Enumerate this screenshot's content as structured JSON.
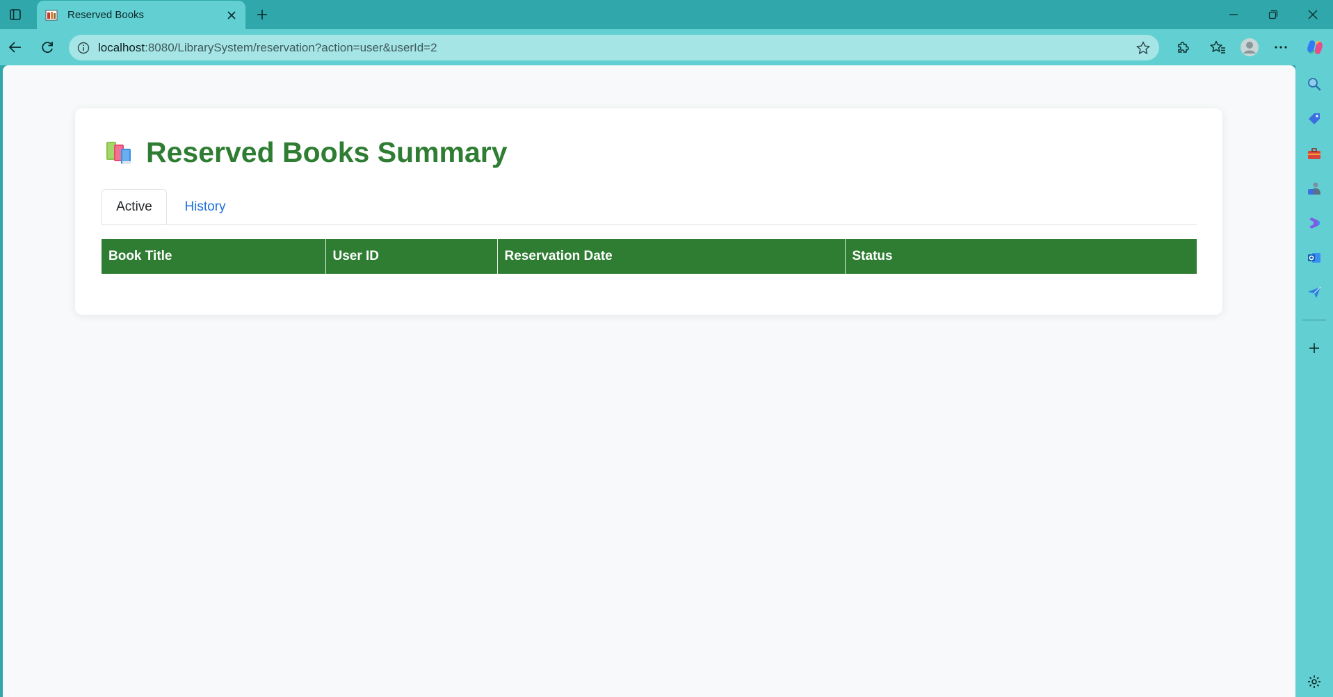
{
  "browser": {
    "tab_title": "Reserved Books",
    "url_host": "localhost",
    "url_path": ":8080/LibrarySystem/reservation?action=user&userId=2",
    "theme_color": "#2fa7ab"
  },
  "page": {
    "title": "Reserved Books Summary",
    "title_icon": "books-icon",
    "accent_color": "#2e7d32",
    "link_color": "#1e6fd9",
    "tabs": [
      {
        "label": "Active",
        "active": true
      },
      {
        "label": "History",
        "active": false
      }
    ],
    "table": {
      "headers": [
        "Book Title",
        "User ID",
        "Reservation Date",
        "Status"
      ],
      "rows": []
    }
  }
}
